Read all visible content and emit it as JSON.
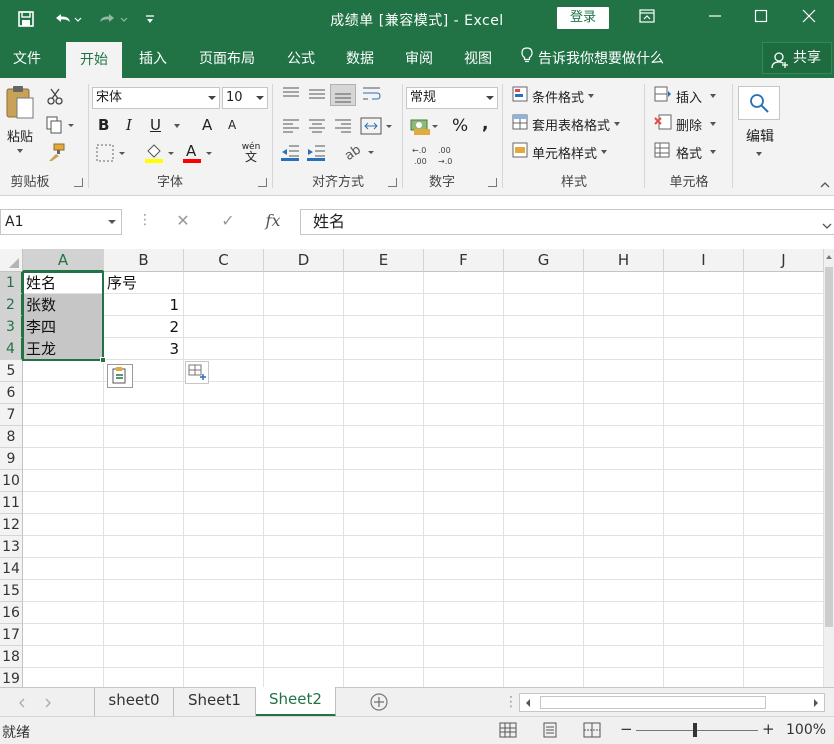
{
  "titlebar": {
    "title": "成绩单  [兼容模式]  -  Excel",
    "login": "登录",
    "icons": [
      "save-icon",
      "undo-icon",
      "redo-icon",
      "customize-qat-icon",
      "ribbon-display-icon",
      "minimize-icon",
      "maximize-icon",
      "close-icon"
    ]
  },
  "tabs": {
    "file": "文件",
    "home": "开始",
    "insert": "插入",
    "layout": "页面布局",
    "formulas": "公式",
    "data": "数据",
    "review": "审阅",
    "view": "视图",
    "tell": "告诉我你想要做什么",
    "share": "共享"
  },
  "ribbon": {
    "clipboard": {
      "paste": "粘贴",
      "label": "剪贴板"
    },
    "font": {
      "name": "宋体",
      "size": "10",
      "bold": "B",
      "italic": "I",
      "underline": "U",
      "grow": "A",
      "shrink": "A",
      "fontcolor": "A",
      "phonetic_top": "wén",
      "phonetic_bottom": "文",
      "label": "字体"
    },
    "align": {
      "label": "对齐方式"
    },
    "number": {
      "format": "常规",
      "percent": "%",
      "comma": ",",
      "inc_dec": ".0→.00",
      "label": "数字"
    },
    "styles": {
      "conditional": "条件格式",
      "table": "套用表格格式",
      "cell": "单元格样式",
      "label": "样式"
    },
    "cells": {
      "insert": "插入",
      "delete": "删除",
      "format": "格式",
      "label": "单元格"
    },
    "editing": {
      "label": "编辑"
    },
    "colors": {
      "accent": "#217346",
      "highlight": "#ffff00",
      "fontcolor": "#ff0000"
    }
  },
  "formula_bar": {
    "namebox": "A1",
    "fx": "fx",
    "content": "姓名"
  },
  "grid": {
    "columns": [
      "A",
      "B",
      "C",
      "D",
      "E",
      "F",
      "G",
      "H",
      "I",
      "J"
    ],
    "rows": [
      "1",
      "2",
      "3",
      "4",
      "5",
      "6",
      "7",
      "8",
      "9",
      "10",
      "11",
      "12",
      "13",
      "14",
      "15",
      "16",
      "17",
      "18",
      "19"
    ],
    "cells": {
      "A1": "姓名",
      "B1": "序号",
      "A2": "张数",
      "B2": "1",
      "A3": "李四",
      "B3": "2",
      "A4": "王龙",
      "B4": "3"
    }
  },
  "sheets": [
    "sheet0",
    "Sheet1",
    "Sheet2"
  ],
  "active_sheet": "Sheet2",
  "status": {
    "ready": "就绪",
    "zoom": "100%",
    "minus": "−",
    "plus": "+"
  }
}
